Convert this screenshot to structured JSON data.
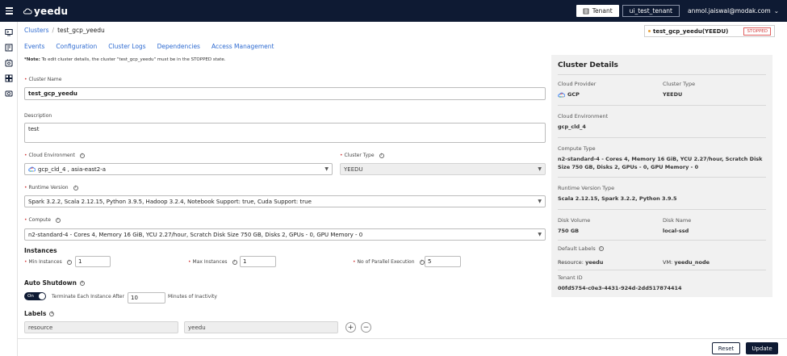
{
  "topbar": {
    "brand": "yeedu",
    "tenant_label": "Tenant",
    "tenant_name": "ui_test_tenant",
    "user_email": "anmol.jaiswal@modak.com",
    "bg_color": "#0e1a33"
  },
  "rail": {
    "icons": [
      "console-icon",
      "notebook-icon",
      "cluster-icon",
      "dashboard-icon",
      "storage-icon"
    ]
  },
  "breadcrumb": {
    "root": "Clusters",
    "separator": "/",
    "current": "test_gcp_yeedu"
  },
  "status_card": {
    "name": "test_gcp_yeedu(YEEDU)",
    "status": "STOPPED",
    "status_color": "#d23a3a"
  },
  "tabs": [
    {
      "label": "Events"
    },
    {
      "label": "Configuration"
    },
    {
      "label": "Cluster Logs"
    },
    {
      "label": "Dependencies"
    },
    {
      "label": "Access Management"
    }
  ],
  "note": {
    "prefix": "*Note:",
    "text": "To edit cluster details, the cluster \"test_gcp_yeedu\" must be in the STOPPED state."
  },
  "form": {
    "cluster_name_label": "Cluster Name",
    "cluster_name_value": "test_gcp_yeedu",
    "description_label": "Description",
    "description_value": "test",
    "cloud_env_label": "Cloud Environment",
    "cloud_env_value": "gcp_cld_4 , asia-east2-a",
    "cluster_type_label": "Cluster Type",
    "cluster_type_value": "YEEDU",
    "runtime_label": "Runtime Version",
    "runtime_value": "Spark 3.2.2, Scala 2.12.15, Python 3.9.5, Hadoop 3.2.4, Notebook Support: true, Cuda Support: true",
    "compute_label": "Compute",
    "compute_value": "n2-standard-4  -  Cores  4,   Memory  16 GiB,   YCU  2.27/hour,   Scratch Disk Size  750 GB,   Disks  2, GPUs - 0, GPU Memory - 0",
    "instances_title": "Instances",
    "min_label": "Min Instances",
    "min_value": "1",
    "max_label": "Max Instances",
    "max_value": "1",
    "parallel_label": "No of Parallel Execution",
    "parallel_value": "5",
    "auto_shutdown_title": "Auto Shutdown",
    "toggle_label": "On",
    "terminate_label": "Terminate Each Instance After",
    "terminate_value": "10",
    "terminate_suffix": "Minutes of Inactivity",
    "labels_title": "Labels",
    "label_key": "resource",
    "label_value": "yeedu",
    "add_symbol": "+",
    "remove_symbol": "−"
  },
  "details": {
    "title": "Cluster Details",
    "cloud_provider_label": "Cloud Provider",
    "cloud_provider_value": "GCP",
    "cluster_type_label": "Cluster Type",
    "cluster_type_value": "YEEDU",
    "cloud_env_label": "Cloud Environment",
    "cloud_env_value": "gcp_cld_4",
    "compute_type_label": "Compute Type",
    "compute_type_value": "n2-standard-4 - Cores 4, Memory 16 GiB, YCU 2.27/hour, Scratch Disk Size 750 GB, Disks 2, GPUs - 0, GPU Memory - 0",
    "runtime_type_label": "Runtime Version Type",
    "runtime_type_value": "Scala 2.12.15, Spark 3.2.2, Python 3.9.5",
    "disk_volume_label": "Disk Volume",
    "disk_volume_value": "750 GB",
    "disk_name_label": "Disk Name",
    "disk_name_value": "local-ssd",
    "default_labels_label": "Default Labels",
    "resource_label": "Resource:",
    "resource_value": "yeedu",
    "vm_label": "VM:",
    "vm_value": "yeedu_node",
    "tenant_id_label": "Tenant ID",
    "tenant_id_value": "00fd5754-c0e3-4431-924d-2dd517874414"
  },
  "footer": {
    "reset_label": "Reset",
    "update_label": "Update"
  }
}
